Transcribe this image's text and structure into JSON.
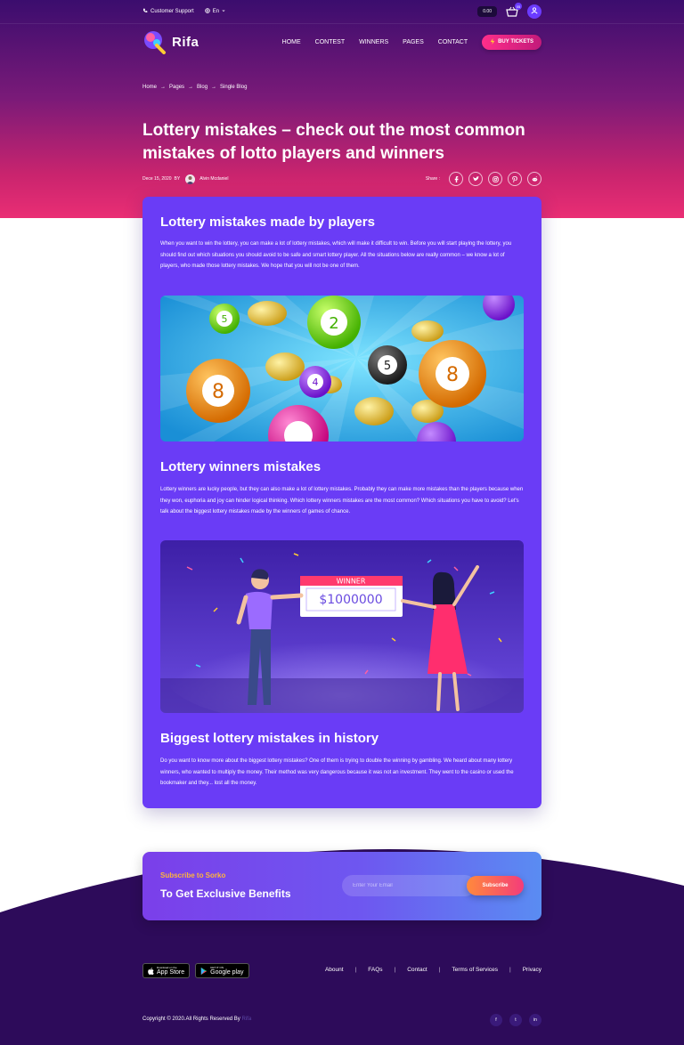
{
  "topbar": {
    "support_label": "Customer Support",
    "lang_label": "En",
    "balance": "0.00",
    "cart_count": "05"
  },
  "brand": {
    "name": "Rifa"
  },
  "nav": {
    "items": [
      {
        "label": "HOME"
      },
      {
        "label": "CONTEST"
      },
      {
        "label": "WINNERS"
      },
      {
        "label": "PAGES"
      },
      {
        "label": "CONTACT"
      }
    ],
    "cta_label": "BUY TICKETS"
  },
  "breadcrumb": {
    "items": [
      "Home",
      "Pages",
      "Blog",
      "Single Blog"
    ],
    "separator": "→"
  },
  "post": {
    "title": "Lottery mistakes – check out the most common mistakes of lotto players and winners",
    "date": "Dece 15, 2020",
    "by": "BY",
    "author": "Alvin Mcdaniel",
    "share_label": "Share :",
    "share_icons": [
      "facebook-icon",
      "twitter-icon",
      "instagram-icon",
      "pinterest-icon",
      "reddit-icon"
    ],
    "sections": [
      {
        "title": "Lottery mistakes made by players",
        "text": "When you want to win the lottery, you can make a lot of lottery mistakes, which will make it difficult to win. Before you will start playing the lottery, you should find out which situations you should avoid to be safe and smart lottery player. All the situations below are really common – we know a lot of players, who made those lottery mistakes. We hope that you will not be one of them."
      },
      {
        "title": "Lottery winners mistakes",
        "text": "Lottery winners are lucky people, but they can also make a lot of lottery mistakes. Probably they can make more mistakes than the players because when they won, euphoria and joy can hinder logical thinking. Which lottery winners mistakes are the most common? Which situations you have to avoid? Let's talk about the biggest lottery mistakes made by the winners of games of chance."
      },
      {
        "title": "Biggest lottery mistakes in history",
        "text": "Do you want to know more about the biggest lottery mistakes? One of them is trying to double the winning by gambling. We heard about many lottery winners, who wanted to multiply the money. Their method was very dangerous because it was not an investment. They went to the casino or used the bookmaker and they... lost all the money."
      }
    ],
    "winner_banner": "WINNER",
    "winner_amount": "$1000000"
  },
  "subscribe": {
    "label": "Subscribe to Sorko",
    "title": "To Get Exclusive Benefits",
    "placeholder": "Enter Your Email",
    "button": "Subscribe"
  },
  "footer": {
    "app_store": {
      "small": "Download on the",
      "big": "App Store"
    },
    "google_play": {
      "small": "GET IT ON",
      "big": "Google play"
    },
    "links": [
      {
        "label": "Abount"
      },
      {
        "label": "FAQs"
      },
      {
        "label": "Contact"
      },
      {
        "label": "Terms of Services"
      },
      {
        "label": "Privacy"
      }
    ],
    "copyright": "Copyright © 2020.All Rights Reserved By",
    "copyright_brand": "Rifa",
    "social": [
      "f",
      "t",
      "in"
    ]
  },
  "colors": {
    "card": "#6a3cf6",
    "footer": "#2d0b5a",
    "accent_orange": "#ffb43c",
    "accent_pink": "#ff2e8a"
  }
}
